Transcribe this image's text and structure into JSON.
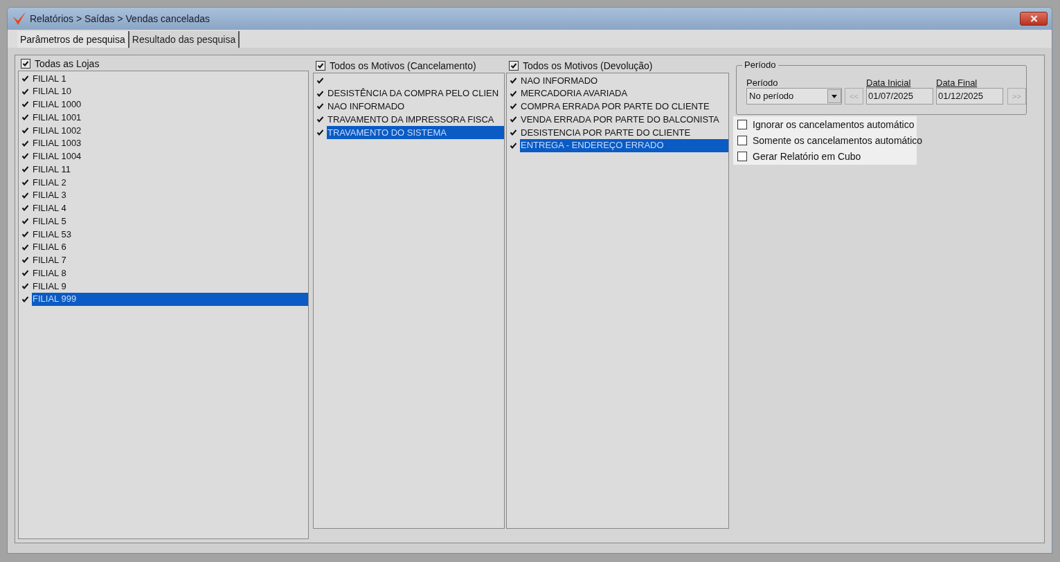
{
  "window": {
    "title": "Relatórios > Saídas > Vendas canceladas"
  },
  "tabs": [
    {
      "label": "Parâmetros de pesquisa",
      "selected": true
    },
    {
      "label": "Resultado das pesquisa",
      "selected": false
    }
  ],
  "stores": {
    "header": {
      "label": "Todas as Lojas",
      "checked": true
    },
    "items": [
      {
        "label": "FILIAL 1",
        "checked": true,
        "selected": false
      },
      {
        "label": "FILIAL 10",
        "checked": true,
        "selected": false
      },
      {
        "label": "FILIAL 1000",
        "checked": true,
        "selected": false
      },
      {
        "label": "FILIAL 1001",
        "checked": true,
        "selected": false
      },
      {
        "label": "FILIAL 1002",
        "checked": true,
        "selected": false
      },
      {
        "label": "FILIAL 1003",
        "checked": true,
        "selected": false
      },
      {
        "label": "FILIAL 1004",
        "checked": true,
        "selected": false
      },
      {
        "label": "FILIAL 11",
        "checked": true,
        "selected": false
      },
      {
        "label": "FILIAL 2",
        "checked": true,
        "selected": false
      },
      {
        "label": "FILIAL 3",
        "checked": true,
        "selected": false
      },
      {
        "label": "FILIAL 4",
        "checked": true,
        "selected": false
      },
      {
        "label": "FILIAL 5",
        "checked": true,
        "selected": false
      },
      {
        "label": "FILIAL 53",
        "checked": true,
        "selected": false
      },
      {
        "label": "FILIAL 6",
        "checked": true,
        "selected": false
      },
      {
        "label": "FILIAL 7",
        "checked": true,
        "selected": false
      },
      {
        "label": "FILIAL 8",
        "checked": true,
        "selected": false
      },
      {
        "label": "FILIAL 9",
        "checked": true,
        "selected": false
      },
      {
        "label": "FILIAL 999",
        "checked": true,
        "selected": true
      }
    ]
  },
  "cancel_reasons": {
    "header": {
      "label": "Todos os Motivos (Cancelamento)",
      "checked": true
    },
    "items": [
      {
        "checked": true,
        "selected": false
      },
      {
        "label": "DESISTÊNCIA DA COMPRA PELO CLIEN",
        "checked": true,
        "selected": false
      },
      {
        "label": "NAO INFORMADO",
        "checked": true,
        "selected": false
      },
      {
        "label": "TRAVAMENTO DA IMPRESSORA FISCA",
        "checked": true,
        "selected": false
      },
      {
        "label": "TRAVAMENTO DO SISTEMA",
        "checked": true,
        "selected": true
      }
    ]
  },
  "return_reasons": {
    "header": {
      "label": "Todos os Motivos (Devolução)",
      "checked": true
    },
    "items": [
      {
        "label": "NAO INFORMADO",
        "checked": true,
        "selected": false
      },
      {
        "label": "MERCADORIA AVARIADA",
        "checked": true,
        "selected": false
      },
      {
        "label": "COMPRA ERRADA POR PARTE DO CLIENTE",
        "checked": true,
        "selected": false
      },
      {
        "label": "VENDA ERRADA POR PARTE DO BALCONISTA",
        "checked": true,
        "selected": false
      },
      {
        "label": "DESISTENCIA POR PARTE DO CLIENTE",
        "checked": true,
        "selected": false
      },
      {
        "label": "ENTREGA - ENDEREÇO ERRADO",
        "checked": true,
        "selected": true
      }
    ]
  },
  "period": {
    "group_title": "Período",
    "select_label": "Período",
    "select_value": "No período",
    "prev_button": "<<",
    "start_label": "Data Inicial",
    "start_value": "01/07/2025",
    "end_label": "Data Final",
    "end_value": "01/12/2025",
    "next_button": ">>"
  },
  "options": [
    {
      "label": "Ignorar os cancelamentos automático",
      "checked": false
    },
    {
      "label": "Somente os cancelamentos automático",
      "checked": false
    },
    {
      "label": "Gerar Relatório em Cubo",
      "checked": false
    }
  ]
}
